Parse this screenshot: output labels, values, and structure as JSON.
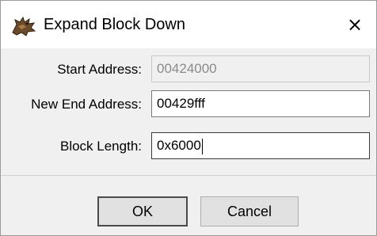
{
  "dialog": {
    "title": "Expand Block Down",
    "icon": "dragon-icon",
    "close_label": "×"
  },
  "form": {
    "start_address": {
      "label": "Start Address:",
      "value": "00424000",
      "readonly": true
    },
    "new_end_address": {
      "label": "New End Address:",
      "value": "00429fff"
    },
    "block_length": {
      "label": "Block Length:",
      "value": "0x6000"
    }
  },
  "buttons": {
    "ok": "OK",
    "cancel": "Cancel"
  }
}
